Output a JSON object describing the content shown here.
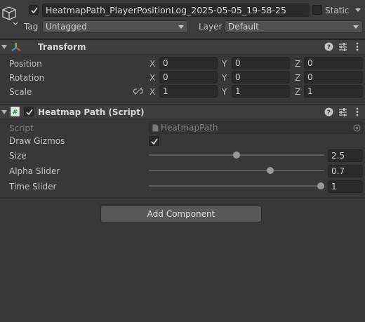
{
  "object": {
    "name": "HeatmapPath_PlayerPositionLog_2025-05-05_19-58-25",
    "static_label": "Static",
    "tag_label": "Tag",
    "tag_value": "Untagged",
    "layer_label": "Layer",
    "layer_value": "Default"
  },
  "transform": {
    "title": "Transform",
    "rows": [
      {
        "label": "Position",
        "x": "0",
        "y": "0",
        "z": "0"
      },
      {
        "label": "Rotation",
        "x": "0",
        "y": "0",
        "z": "0"
      },
      {
        "label": "Scale",
        "x": "1",
        "y": "1",
        "z": "1"
      }
    ],
    "axis": {
      "x": "X",
      "y": "Y",
      "z": "Z"
    }
  },
  "heatmap": {
    "title": "Heatmap Path (Script)",
    "script_label": "Script",
    "script_value": "HeatmapPath",
    "draw_gizmos_label": "Draw Gizmos",
    "size_label": "Size",
    "size_value": "2.5",
    "size_fraction": 0.5,
    "alpha_label": "Alpha Slider",
    "alpha_value": "0.7",
    "alpha_fraction": 0.7,
    "time_label": "Time Slider",
    "time_value": "1",
    "time_fraction": 1.0
  },
  "add_component_label": "Add Component",
  "icons": [
    "gameobject-cube-icon",
    "transform-axes-icon",
    "script-hash-icon",
    "help-icon",
    "preset-icon",
    "kebab-menu-icon",
    "link-icon",
    "script-file-icon",
    "object-picker-icon"
  ]
}
